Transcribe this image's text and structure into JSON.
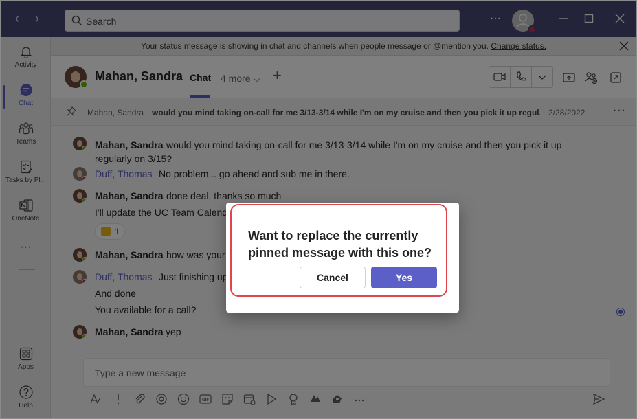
{
  "titlebar": {
    "search_placeholder": "Search",
    "more_glyph": "···"
  },
  "rail": {
    "items": [
      {
        "label": "Activity",
        "icon": "bell-icon"
      },
      {
        "label": "Chat",
        "icon": "chat-icon",
        "active": true
      },
      {
        "label": "Teams",
        "icon": "teams-icon"
      },
      {
        "label": "Tasks by Pl...",
        "icon": "tasks-icon"
      },
      {
        "label": "OneNote",
        "icon": "onenote-icon"
      },
      {
        "label": "Apps",
        "icon": "apps-icon"
      },
      {
        "label": "Help",
        "icon": "help-icon"
      }
    ],
    "more_glyph": "···"
  },
  "banner": {
    "text": "Your status message is showing in chat and channels when people message or @mention you.",
    "link": "Change status."
  },
  "chat_header": {
    "name": "Mahan, Sandra",
    "tab_chat": "Chat",
    "tab_more": "4 more ⌵",
    "add": "+"
  },
  "pinned": {
    "author": "Mahan, Sandra",
    "message": "would you mind taking on-call for me 3/13-3/14 while I'm on my cruise and then you pick it up regul...",
    "date": "2/28/2022",
    "more": "···"
  },
  "messages": [
    {
      "author": "Mahan, Sandra",
      "text": "would you mind taking on-call for me 3/13-3/14 while I'm on my cruise and then you pick it up",
      "text2": "regularly on 3/15?"
    },
    {
      "author": "Duff, Thomas",
      "text": "No problem... go ahead and sub me in there."
    },
    {
      "author": "Mahan, Sandra",
      "text": "done deal. thanks so much",
      "text2": "I'll update the UC Team Calend",
      "reaction_count": "1"
    },
    {
      "author": "Mahan, Sandra",
      "text": "how was your"
    },
    {
      "author": "Duff, Thomas",
      "text": "Just finishing up",
      "text2": "And done",
      "text3": "You available for a call?"
    },
    {
      "author": "Mahan, Sandra",
      "text": "yep"
    }
  ],
  "compose": {
    "placeholder": "Type a new message"
  },
  "dialog": {
    "title": "Want to replace the currently pinned message with this one?",
    "cancel": "Cancel",
    "yes": "Yes"
  },
  "colors": {
    "titlebar": "#464775",
    "accent": "#5b5fc7",
    "highlight": "#e0454c"
  }
}
